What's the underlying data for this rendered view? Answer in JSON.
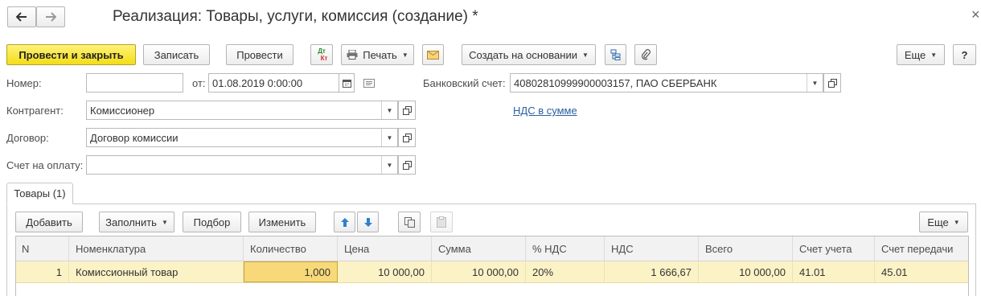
{
  "window": {
    "title": "Реализация: Товары, услуги, комиссия (создание) *",
    "close_glyph": "×"
  },
  "nav": {
    "back_icon": "arrow-left-icon",
    "forward_icon": "arrow-right-icon"
  },
  "toolbar": {
    "post_close": "Провести и закрыть",
    "save": "Записать",
    "post": "Провести",
    "dt_kt_top": "Дт",
    "dt_kt_bottom": "Кт",
    "print": "Печать",
    "create_based": "Создать на основании",
    "more": "Еще",
    "help": "?"
  },
  "form": {
    "number_label": "Номер:",
    "number_value": "",
    "date_label": "от:",
    "date_value": "01.08.2019  0:00:00",
    "bank_label": "Банковский счет:",
    "bank_value": "40802810999900003157, ПАО СБЕРБАНК",
    "counterparty_label": "Контрагент:",
    "counterparty_value": "Комиссионер",
    "vat_link": "НДС в сумме",
    "contract_label": "Договор:",
    "contract_value": "Договор комиссии",
    "invoice_label": "Счет на оплату:",
    "invoice_value": ""
  },
  "tabs": [
    {
      "label": "Товары (1)",
      "active": true
    }
  ],
  "table_toolbar": {
    "add": "Добавить",
    "fill": "Заполнить",
    "pick": "Подбор",
    "change": "Изменить",
    "more": "Еще"
  },
  "table": {
    "columns": [
      "N",
      "Номенклатура",
      "Количество",
      "Цена",
      "Сумма",
      "% НДС",
      "НДС",
      "Всего",
      "Счет учета",
      "Счет передачи"
    ],
    "rows": [
      [
        "1",
        "Комиссионный товар",
        "1,000",
        "10 000,00",
        "10 000,00",
        "20%",
        "1 666,67",
        "10 000,00",
        "41.01",
        "45.01"
      ]
    ]
  },
  "colors": {
    "primary_button": "#f3dd17",
    "selected_row": "#fbf2c6",
    "link": "#2b5f9e",
    "active_cell": "#f7d97a"
  }
}
